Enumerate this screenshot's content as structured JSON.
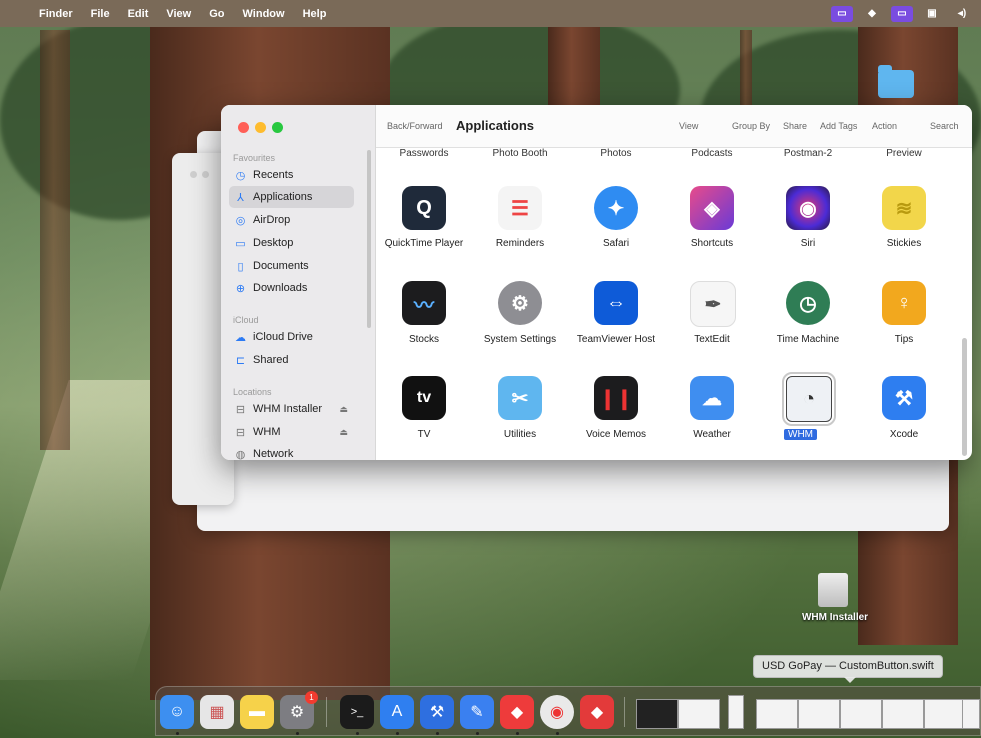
{
  "menubar": {
    "apple": "",
    "items": [
      "Finder",
      "File",
      "Edit",
      "View",
      "Go",
      "Window",
      "Help"
    ]
  },
  "window": {
    "sidebar": {
      "favourites_header": "Favourites",
      "favourites": [
        {
          "label": "Recents",
          "icon": "clock-icon"
        },
        {
          "label": "Applications",
          "icon": "applications-icon",
          "selected": true
        },
        {
          "label": "AirDrop",
          "icon": "airdrop-icon"
        },
        {
          "label": "Desktop",
          "icon": "desktop-icon"
        },
        {
          "label": "Documents",
          "icon": "document-icon"
        },
        {
          "label": "Downloads",
          "icon": "download-icon"
        }
      ],
      "icloud_header": "iCloud",
      "icloud": [
        {
          "label": "iCloud Drive",
          "icon": "cloud-icon"
        },
        {
          "label": "Shared",
          "icon": "shared-folder-icon"
        }
      ],
      "locations_header": "Locations",
      "locations": [
        {
          "label": "WHM Installer",
          "icon": "drive-icon"
        },
        {
          "label": "WHM",
          "icon": "drive-icon"
        },
        {
          "label": "Network",
          "icon": "network-icon"
        }
      ]
    },
    "toolbar": {
      "back_forward": "Back/Forward",
      "title": "Applications",
      "view": "View",
      "group_by": "Group By",
      "share": "Share",
      "add_tags": "Add Tags",
      "action": "Action",
      "search": "Search"
    },
    "top_row_labels": [
      "Passwords",
      "Photo Booth",
      "Photos",
      "Podcasts",
      "Postman-2",
      "Preview"
    ],
    "apps": [
      {
        "label": "QuickTime Player",
        "icon": "quicktime-icon",
        "color": "#1f2a3a"
      },
      {
        "label": "Reminders",
        "icon": "reminders-icon",
        "color": "#f4f4f4"
      },
      {
        "label": "Safari",
        "icon": "safari-icon",
        "color": "#2f8cf2"
      },
      {
        "label": "Shortcuts",
        "icon": "shortcuts-icon",
        "color": "#6a3ad6"
      },
      {
        "label": "Siri",
        "icon": "siri-icon",
        "color": "#2a1a3c"
      },
      {
        "label": "Stickies",
        "icon": "stickies-icon",
        "color": "#f2d64a"
      },
      {
        "label": "Stocks",
        "icon": "stocks-icon",
        "color": "#1c1c1e"
      },
      {
        "label": "System Settings",
        "icon": "gear-icon",
        "color": "#8e8e93"
      },
      {
        "label": "TeamViewer Host",
        "icon": "teamviewer-icon",
        "color": "#0e5bd8"
      },
      {
        "label": "TextEdit",
        "icon": "textedit-icon",
        "color": "#f6f6f6"
      },
      {
        "label": "Time Machine",
        "icon": "time-machine-icon",
        "color": "#2f7d55"
      },
      {
        "label": "Tips",
        "icon": "lightbulb-icon",
        "color": "#f2a81e"
      },
      {
        "label": "TV",
        "icon": "tv-icon",
        "color": "#111111"
      },
      {
        "label": "Utilities",
        "icon": "utilities-folder-icon",
        "color": "#5fb6ef"
      },
      {
        "label": "Voice Memos",
        "icon": "voice-memos-icon",
        "color": "#1c1c1e"
      },
      {
        "label": "Weather",
        "icon": "weather-icon",
        "color": "#3f8ef0"
      },
      {
        "label": "WHM",
        "icon": "whm-icon",
        "color": "#eef1f5",
        "selected": true
      },
      {
        "label": "Xcode",
        "icon": "xcode-icon",
        "color": "#2e7ef0"
      }
    ]
  },
  "desktop": {
    "drive_label": "WHM Installer",
    "tooltip": "USD GoPay — CustomButton.swift"
  },
  "dock": {
    "apps": [
      {
        "name": "finder-icon",
        "color": "#3d8ff0",
        "glyph": "☺",
        "running": true
      },
      {
        "name": "launchpad-icon",
        "color": "#e6e6e6",
        "glyph": "▦",
        "running": false
      },
      {
        "name": "notes-icon",
        "color": "#f6d24a",
        "glyph": "▬",
        "running": false
      },
      {
        "name": "system-settings-icon",
        "color": "#7d7d82",
        "glyph": "⚙",
        "running": true,
        "badge": "1"
      },
      {
        "name": "terminal-icon",
        "color": "#1b1b1b",
        "glyph": ">_",
        "running": true
      },
      {
        "name": "app-store-icon",
        "color": "#2f7ff0",
        "glyph": "A",
        "running": true
      },
      {
        "name": "xcode-icon",
        "color": "#2e6fe0",
        "glyph": "⚒",
        "running": true
      },
      {
        "name": "xcode-alt-icon",
        "color": "#3a80f0",
        "glyph": "✎",
        "running": true
      },
      {
        "name": "anydesk-icon",
        "color": "#ee3b3b",
        "glyph": "◆",
        "running": true
      },
      {
        "name": "chrome-icon",
        "color": "#e9e9e9",
        "glyph": "◉",
        "running": true
      },
      {
        "name": "anydesk-downloader-icon",
        "color": "#e33a3a",
        "glyph": "◆",
        "running": false
      }
    ]
  }
}
